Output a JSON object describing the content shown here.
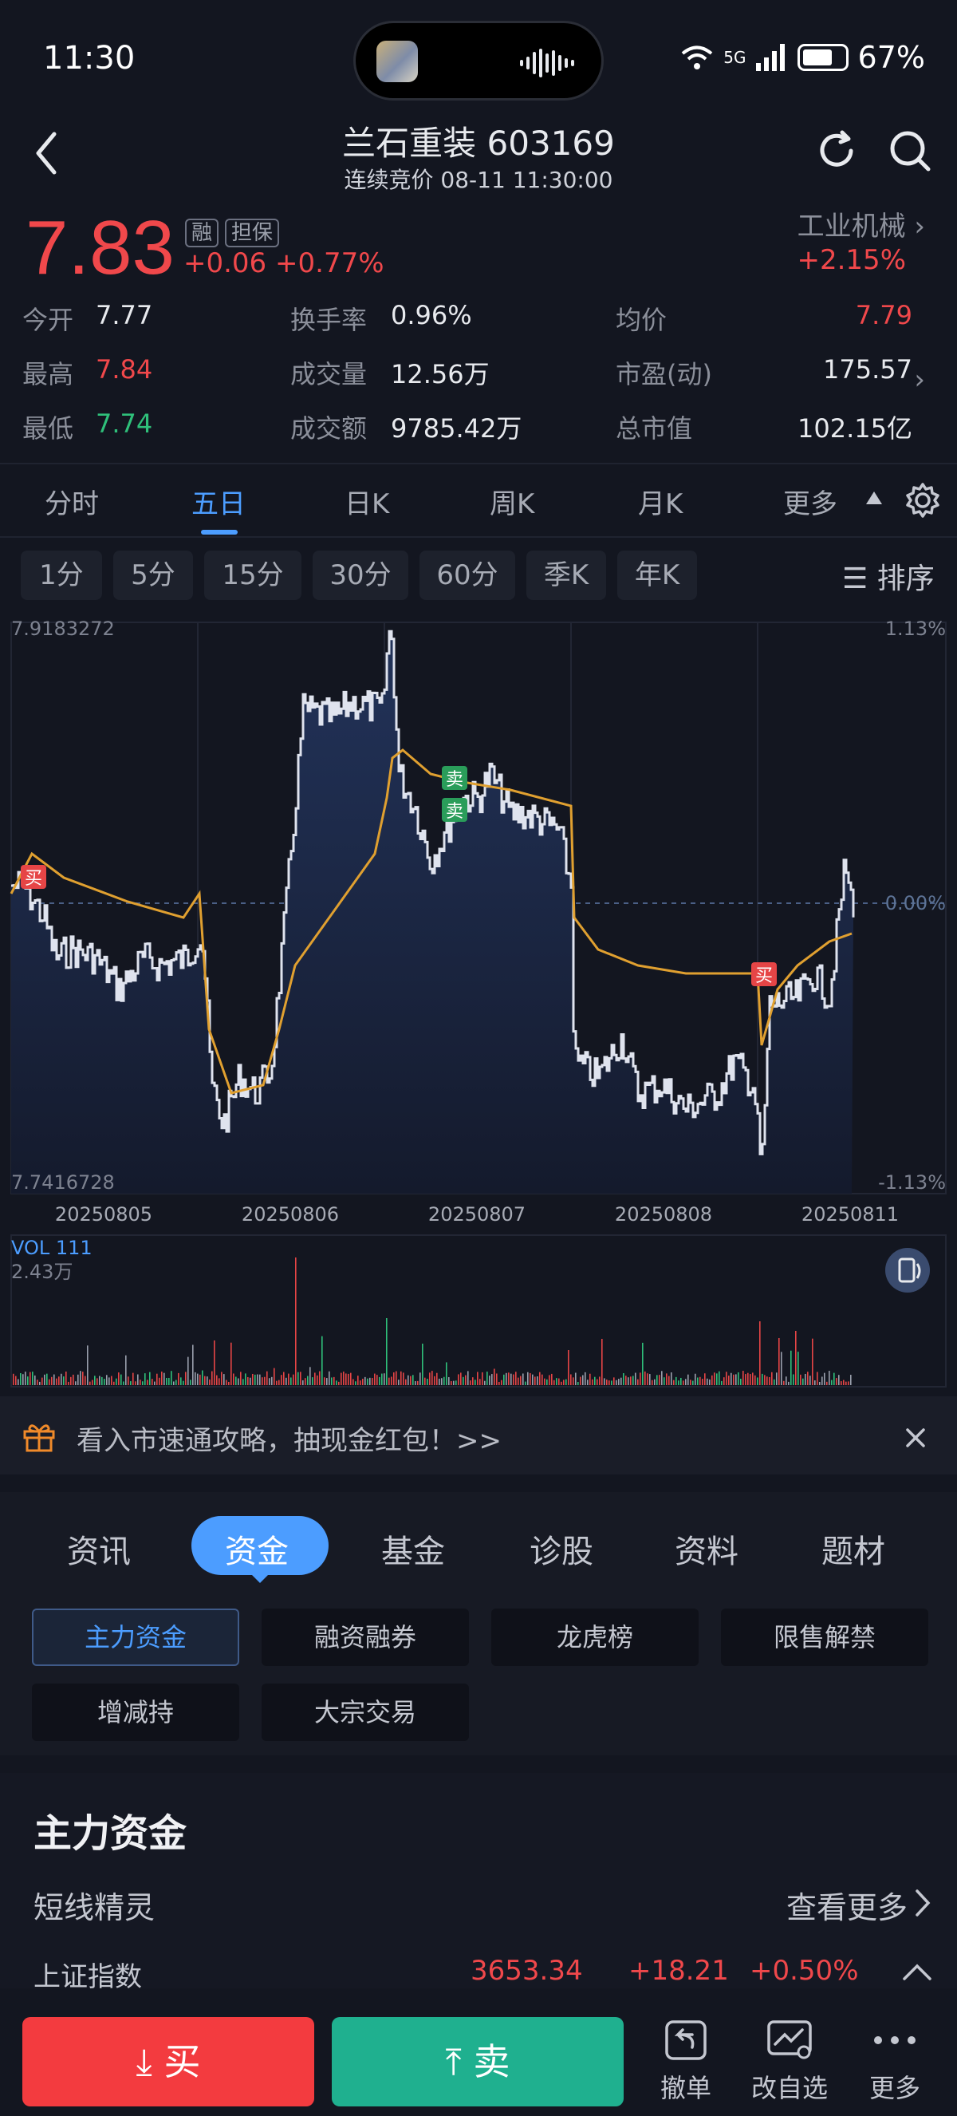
{
  "status": {
    "time": "11:30",
    "network": "5G",
    "battery": "67%"
  },
  "header": {
    "title": "兰石重装 603169",
    "subtitle": "连续竞价 08-11 11:30:00"
  },
  "quote": {
    "price": "7.83",
    "tag_margin": "融",
    "tag_guarantee": "担保",
    "change": "+0.06",
    "change_pct": "+0.77%",
    "industry": "工业机械",
    "industry_chg": "+2.15%"
  },
  "stats": [
    [
      {
        "label": "今开",
        "value": "7.77",
        "tone": "white"
      },
      {
        "label": "换手率",
        "value": "0.96%",
        "tone": "white"
      },
      {
        "label": "均价",
        "value": "7.79",
        "tone": "red"
      }
    ],
    [
      {
        "label": "最高",
        "value": "7.84",
        "tone": "red"
      },
      {
        "label": "成交量",
        "value": "12.56万",
        "tone": "white"
      },
      {
        "label": "市盈(动)",
        "value": "175.57",
        "tone": "white"
      }
    ],
    [
      {
        "label": "最低",
        "value": "7.74",
        "tone": "green"
      },
      {
        "label": "成交额",
        "value": "9785.42万",
        "tone": "white"
      },
      {
        "label": "总市值",
        "value": "102.15亿",
        "tone": "white"
      }
    ]
  ],
  "periods": [
    "分时",
    "五日",
    "日K",
    "周K",
    "月K",
    "更多"
  ],
  "periods_active": "五日",
  "minute_chips": [
    "1分",
    "5分",
    "15分",
    "30分",
    "60分",
    "季K",
    "年K"
  ],
  "sort_label": "排序",
  "chart_axes": {
    "price_max": "7.9183272",
    "price_min": "7.7416728",
    "pct_max": "1.13%",
    "pct_mid": "0.00%",
    "pct_min": "-1.13%",
    "dates": [
      "20250805",
      "20250806",
      "20250807",
      "20250808",
      "20250811"
    ],
    "vol_label": "VOL 111",
    "vol_max": "2.43万",
    "buy_mark": "买",
    "sell_mark": "卖"
  },
  "banner": {
    "text": "看入市速通攻略，抽现金红包！>>"
  },
  "lower_tabs": [
    "资讯",
    "资金",
    "基金",
    "诊股",
    "资料",
    "题材"
  ],
  "lower_tabs_active": "资金",
  "fund_chips_row1": [
    "主力资金",
    "融资融券",
    "龙虎榜",
    "限售解禁"
  ],
  "fund_chips_row2": [
    "增减持",
    "大宗交易"
  ],
  "section": {
    "title": "主力资金",
    "subtitle": "短线精灵",
    "more": "查看更多"
  },
  "index_row": {
    "name": "上证指数",
    "value": "3653.34",
    "change": "+18.21",
    "change_pct": "+0.50%"
  },
  "bottom": {
    "buy": "买",
    "sell": "卖",
    "cancel": "撤单",
    "edit_watch": "改自选",
    "more": "更多"
  },
  "colors": {
    "up": "#f0484b",
    "down": "#2fc07a",
    "accent": "#4c9dff",
    "buy": "#f33b3f",
    "sell": "#1fb08f",
    "avg_line": "#e0a030"
  }
}
